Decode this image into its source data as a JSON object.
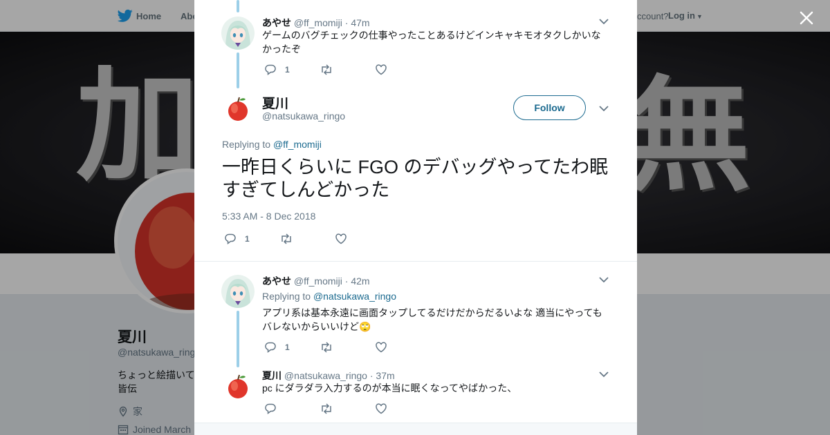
{
  "nav": {
    "home_label": "Home",
    "about_label": "Abo",
    "account_prompt": "ccount?",
    "login_label": "Log in"
  },
  "banner": {
    "left_text": "加",
    "right_text": "無"
  },
  "profile": {
    "name": "夏川",
    "handle": "@natsukawa_ring",
    "bio": "ちょっと絵描いて 皆伝",
    "location": "家",
    "joined": "Joined March"
  },
  "thread": {
    "tweet1": {
      "name": "あやせ",
      "handle": "@ff_momiji",
      "dot": "·",
      "time": "47m",
      "text": "ゲームのバグチェックの仕事やったことあるけどインキャキモオタクしかいなかったぞ",
      "reply_count": "1"
    },
    "main": {
      "name": "夏川",
      "handle": "@natsukawa_ringo",
      "follow_label": "Follow",
      "replying_prefix": "Replying to",
      "replying_handle": "@ff_momiji",
      "text": "一昨日くらいに FGO のデバッグやってたわ眠すぎてしんどかった",
      "date": "5:33 AM - 8 Dec 2018",
      "reply_count": "1"
    },
    "tweet3": {
      "name": "あやせ",
      "handle": "@ff_momiji",
      "dot": "·",
      "time": "42m",
      "replying_prefix": "Replying to",
      "replying_handle": "@natsukawa_ringo",
      "text": "アプリ系は基本永遠に画面タップしてるだけだからだるいよな 適当にやってもバレないからいいけど",
      "emoji": "🙄",
      "reply_count": "1"
    },
    "tweet4": {
      "name": "夏川",
      "handle": "@natsukawa_ringo",
      "dot": "·",
      "time": "37m",
      "text": "pc にダラダラ入力するのが本当に眠くなってやばかった、"
    }
  },
  "colors": {
    "link": "#1b6a8f",
    "muted": "#657786",
    "thread_line": "#9ccfe8",
    "twitter_blue": "#1da1f2"
  },
  "icons": [
    "twitter-bird-icon",
    "close-icon",
    "reply-icon",
    "retweet-icon",
    "like-icon",
    "chevron-down-icon",
    "location-icon",
    "calendar-icon"
  ]
}
